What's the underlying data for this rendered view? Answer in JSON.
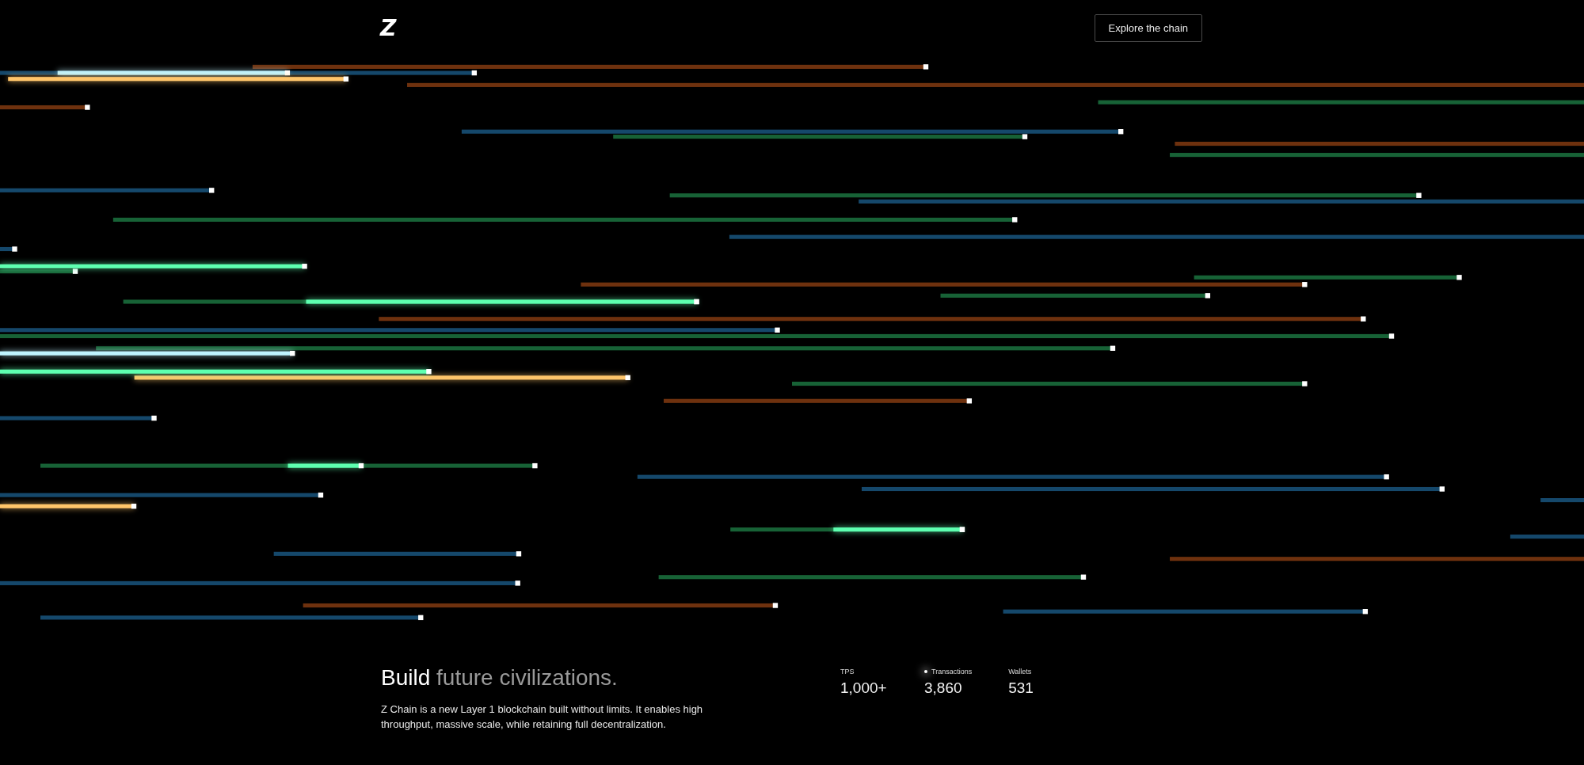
{
  "header": {
    "logo": "Z",
    "button": "Explore the chain"
  },
  "headline": {
    "lead": "Build",
    "rest": "future civilizations."
  },
  "description": "Z Chain is a new Layer 1 blockchain built without limits. It enables high throughput, massive scale, while retaining full decentralization.",
  "stats": [
    {
      "label": "TPS",
      "value": "1,000+",
      "live": false
    },
    {
      "label": "Transactions",
      "value": "3,860",
      "live": true
    },
    {
      "label": "Wallets",
      "value": "531",
      "live": false
    }
  ]
}
